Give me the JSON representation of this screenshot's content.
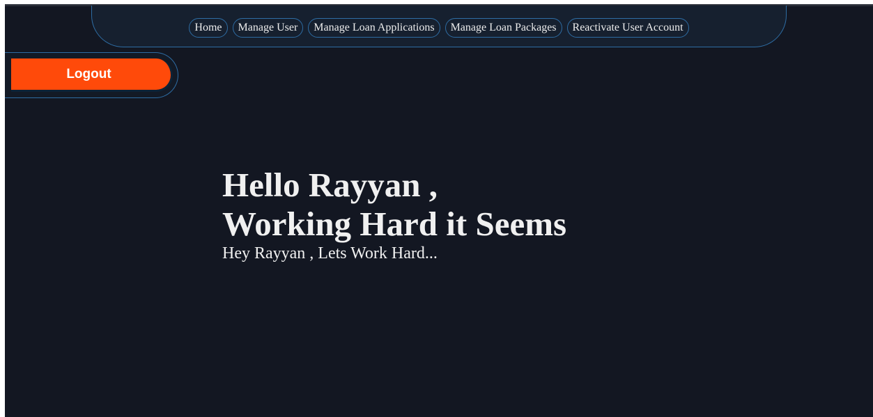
{
  "nav": {
    "links": [
      {
        "label": "Home"
      },
      {
        "label": "Manage User"
      },
      {
        "label": "Manage Loan Applications"
      },
      {
        "label": "Manage Loan Packages"
      },
      {
        "label": "Reactivate User Account"
      }
    ]
  },
  "logout": {
    "label": "Logout"
  },
  "hero": {
    "line1": "Hello Rayyan ,",
    "line2": "Working Hard it Seems",
    "subtitle": "Hey Rayyan , Lets Work Hard..."
  },
  "colors": {
    "background": "#131722",
    "accent_border": "#2e6da4",
    "logout_button": "#ff4a0a",
    "text": "#f0f0f0"
  }
}
